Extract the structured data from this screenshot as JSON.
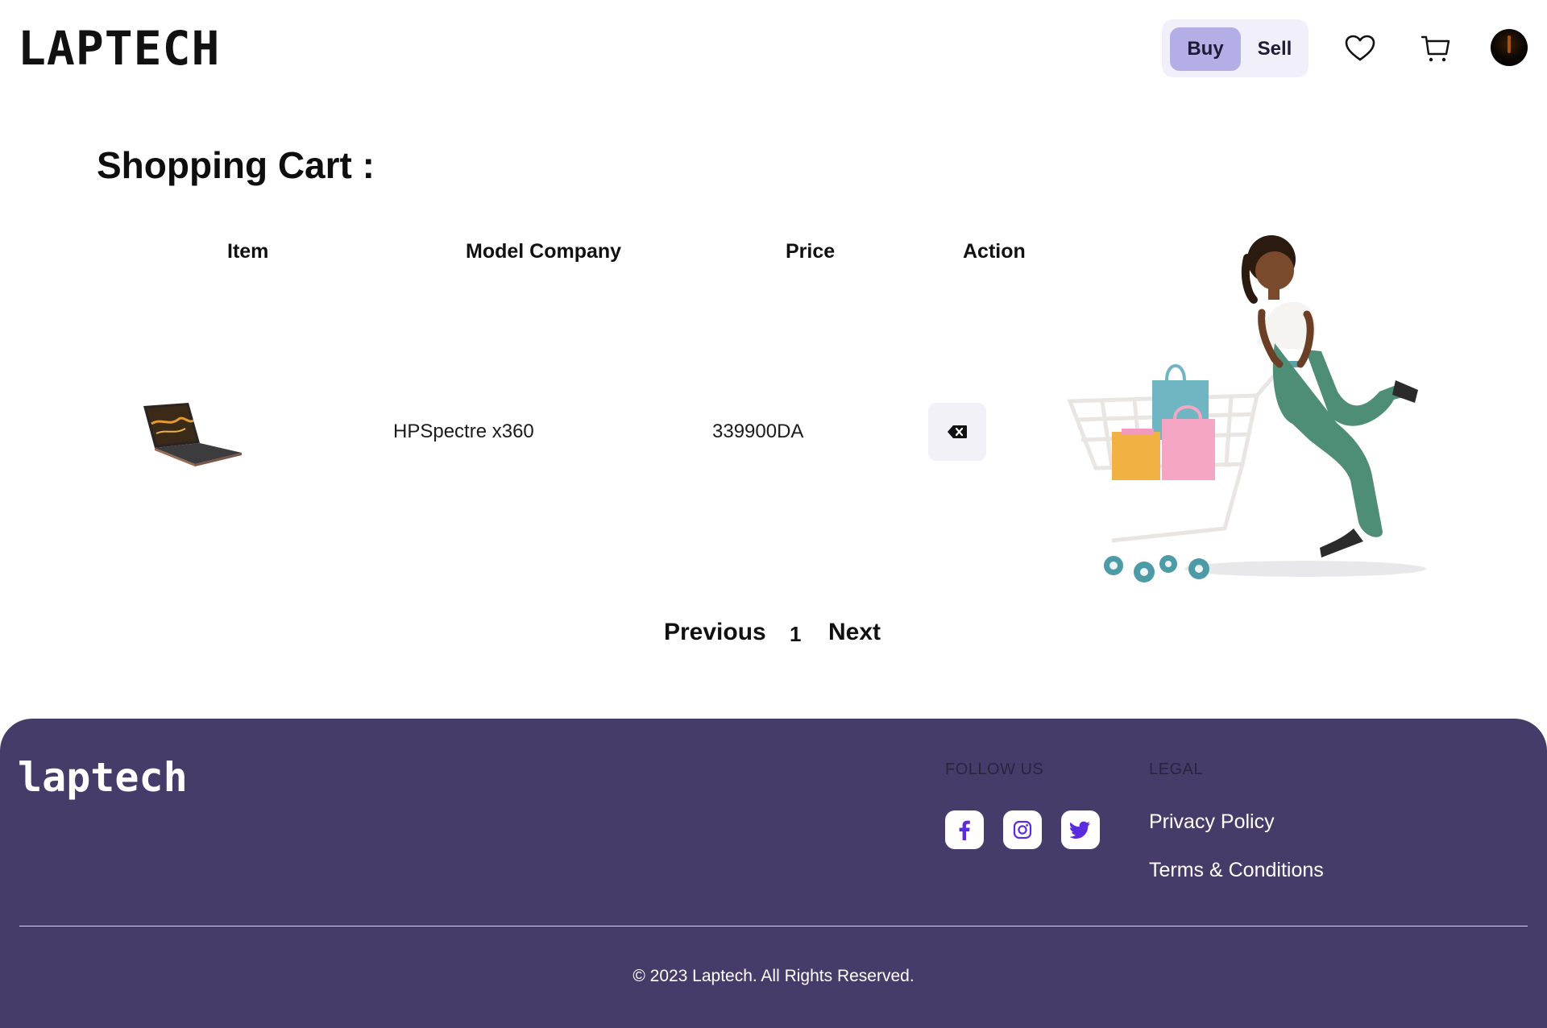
{
  "header": {
    "logo_text": "LAPTECH",
    "toggle": {
      "buy_label": "Buy",
      "sell_label": "Sell",
      "selected": "Buy"
    },
    "icons": {
      "wishlist": "heart-icon",
      "cart": "cart-icon",
      "profile": "avatar"
    }
  },
  "main": {
    "title": "Shopping Cart :",
    "columns": [
      "Item",
      "Model Company",
      "Price",
      "Action"
    ],
    "rows": [
      {
        "item_image": "laptop-image",
        "model": "HPSpectre x360",
        "price": "339900DA",
        "action_icon": "backspace-delete-icon"
      }
    ],
    "pagination": {
      "previous_label": "Previous",
      "current_page": "1",
      "next_label": "Next"
    }
  },
  "footer": {
    "logo_text": "laptech",
    "follow_heading": "FOLLOW US",
    "social_icons": [
      "facebook-icon",
      "instagram-icon",
      "twitter-icon"
    ],
    "legal_heading": "LEGAL",
    "legal_links": [
      "Privacy Policy",
      "Terms & Conditions"
    ],
    "copyright": "© 2023 Laptech. All Rights Reserved.",
    "background": "#463c69"
  },
  "colors": {
    "accent": "#b3aee6",
    "toggle_bg": "#f1eff9",
    "social_icon": "#5b2be0"
  }
}
